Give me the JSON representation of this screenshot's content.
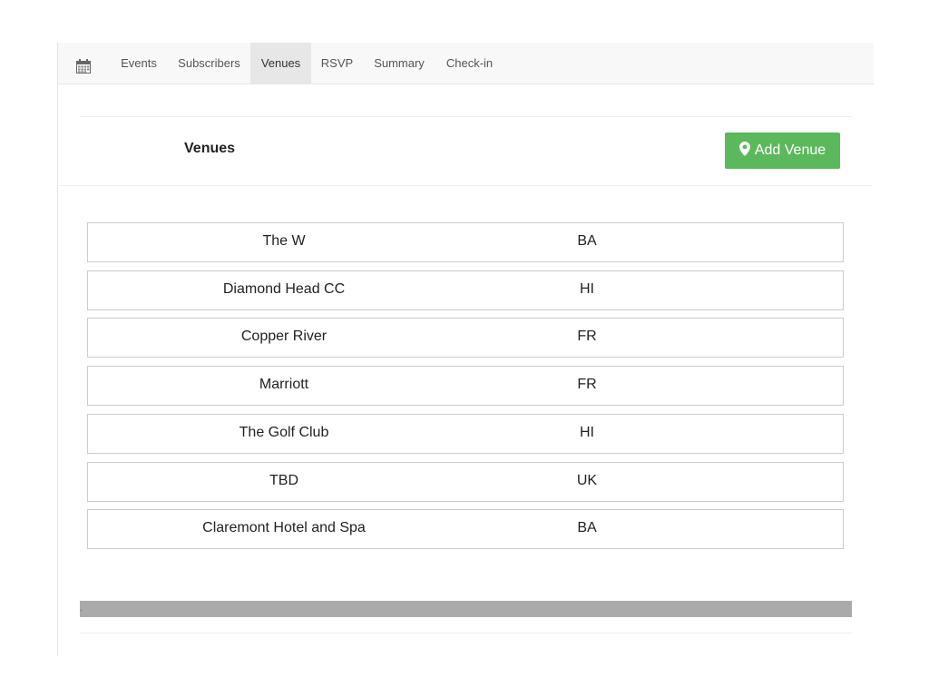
{
  "nav": {
    "brand_icon": "calendar-icon",
    "items": [
      {
        "label": "Events",
        "active": false
      },
      {
        "label": "Subscribers",
        "active": false
      },
      {
        "label": "Venues",
        "active": true
      },
      {
        "label": "RSVP",
        "active": false
      },
      {
        "label": "Summary",
        "active": false
      },
      {
        "label": "Check-in",
        "active": false
      }
    ]
  },
  "page": {
    "title": "Venues",
    "add_button": {
      "label": "Add Venue",
      "icon": "map-marker-icon",
      "color": "#5cb85c"
    }
  },
  "venues": [
    {
      "name": "The W",
      "code": "BA"
    },
    {
      "name": "Diamond Head CC",
      "code": "HI"
    },
    {
      "name": "Copper River",
      "code": "FR"
    },
    {
      "name": "Marriott",
      "code": "FR"
    },
    {
      "name": "The Golf Club",
      "code": "HI"
    },
    {
      "name": "TBD",
      "code": "UK"
    },
    {
      "name": "Claremont Hotel and Spa",
      "code": "BA"
    }
  ],
  "footer": {
    "bar_text": "."
  }
}
